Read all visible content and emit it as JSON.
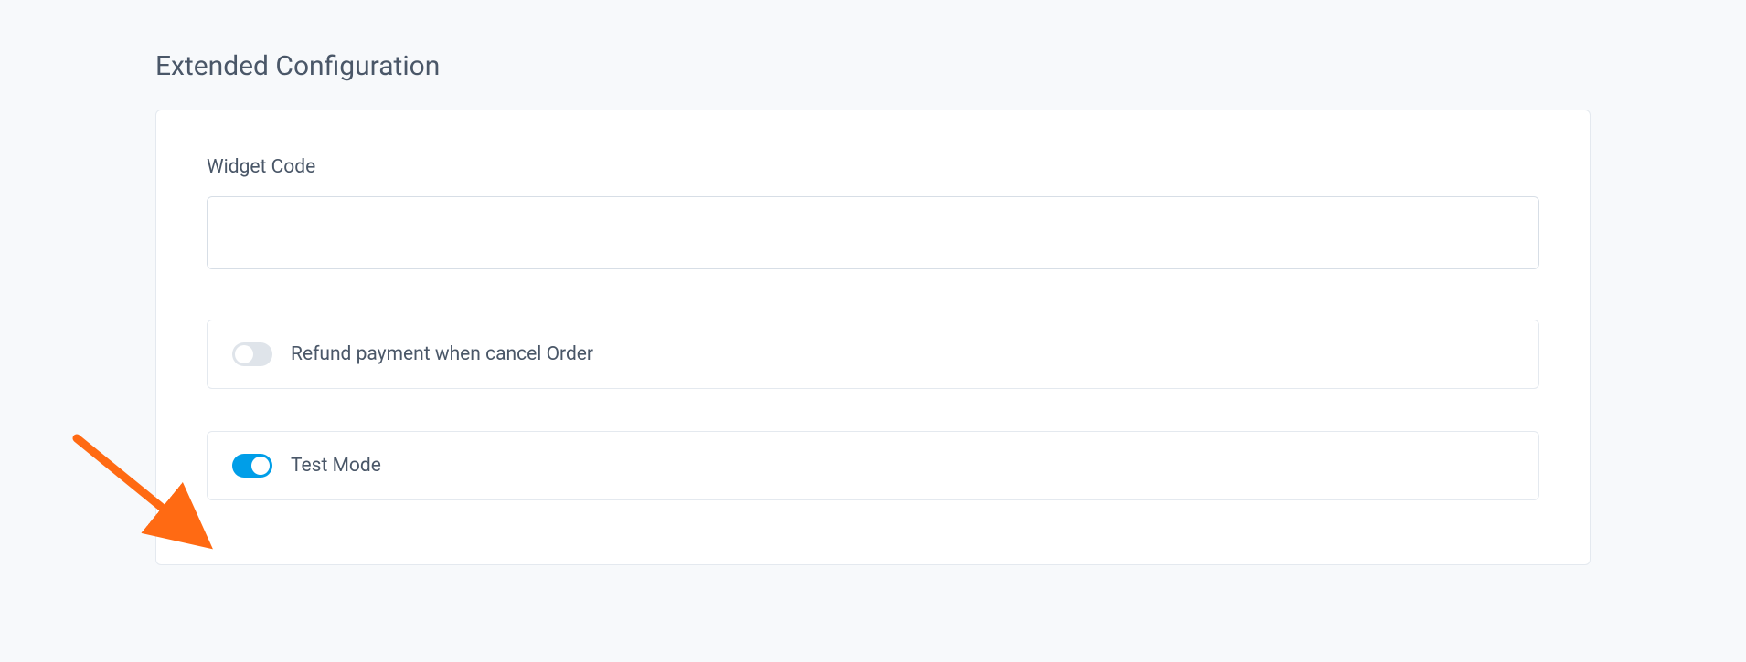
{
  "section": {
    "title": "Extended Configuration"
  },
  "widget_code": {
    "label": "Widget Code",
    "value": ""
  },
  "toggles": {
    "refund": {
      "label": "Refund payment when cancel Order",
      "state": "off"
    },
    "test_mode": {
      "label": "Test Mode",
      "state": "on"
    }
  },
  "annotation": {
    "arrow_color": "#ff6a13"
  }
}
